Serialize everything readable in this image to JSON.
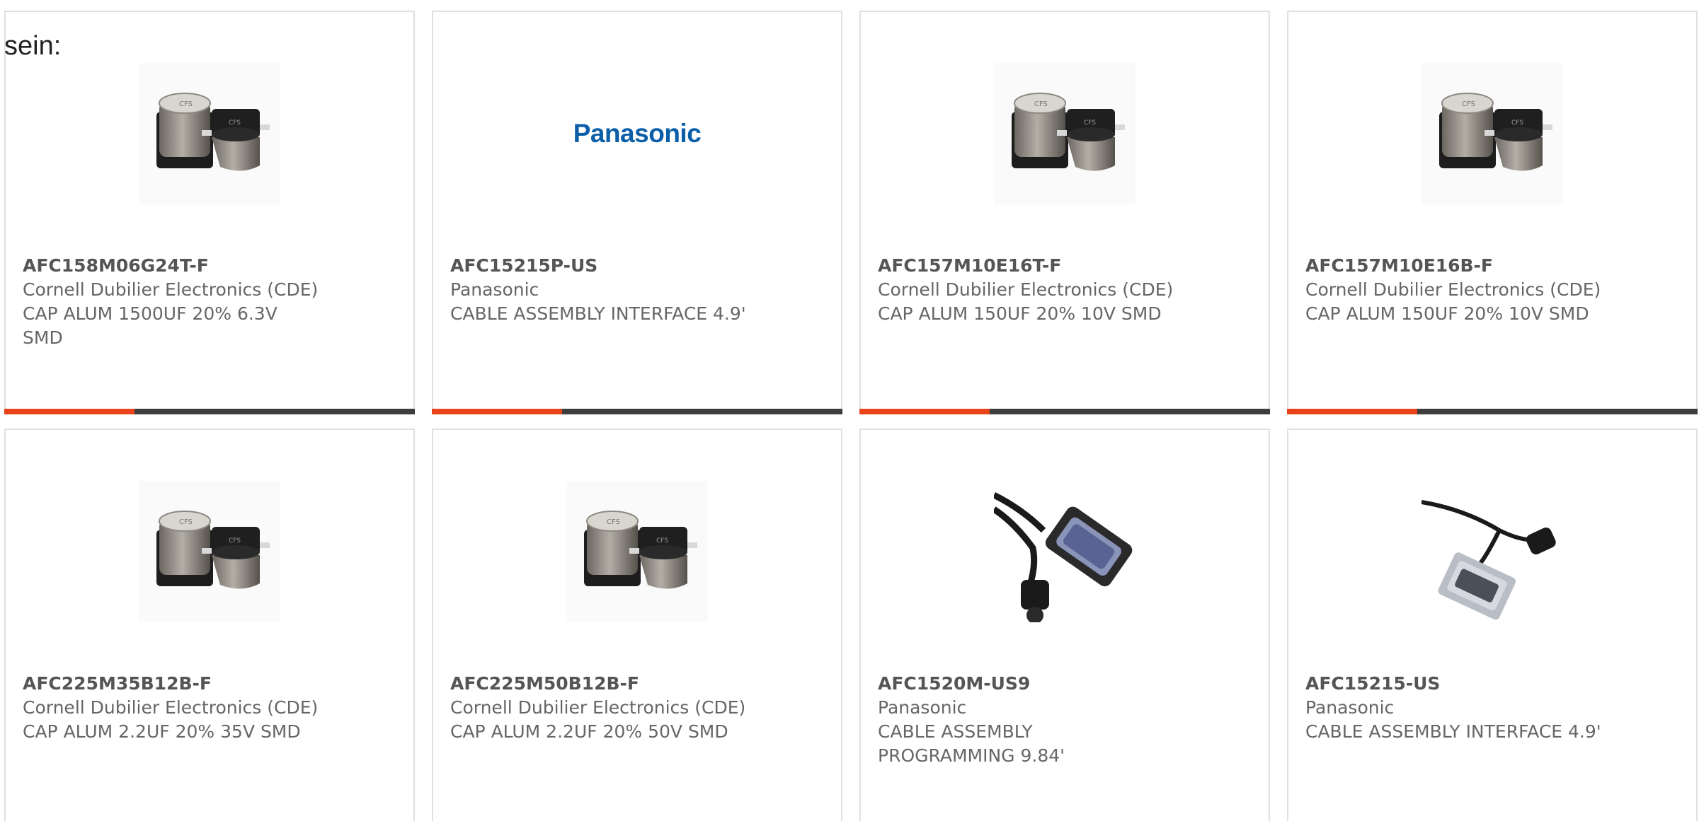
{
  "intro_text": "sein:",
  "products": [
    {
      "part_number": "AFC158M06G24T-F",
      "manufacturer": "Cornell Dubilier Electronics (CDE)",
      "description": "CAP ALUM 1500UF 20% 6.3V SMD",
      "image": "capacitor"
    },
    {
      "part_number": "AFC15215P-US",
      "manufacturer": "Panasonic",
      "description": "CABLE ASSEMBLY INTERFACE 4.9'",
      "image": "panasonic-logo",
      "logo_text": "Panasonic"
    },
    {
      "part_number": "AFC157M10E16T-F",
      "manufacturer": "Cornell Dubilier Electronics (CDE)",
      "description": "CAP ALUM 150UF 20% 10V SMD",
      "image": "capacitor"
    },
    {
      "part_number": "AFC157M10E16B-F",
      "manufacturer": "Cornell Dubilier Electronics (CDE)",
      "description": "CAP ALUM 150UF 20% 10V SMD",
      "image": "capacitor"
    },
    {
      "part_number": "AFC225M35B12B-F",
      "manufacturer": "Cornell Dubilier Electronics (CDE)",
      "description": "CAP ALUM 2.2UF 20% 35V SMD",
      "image": "capacitor"
    },
    {
      "part_number": "AFC225M50B12B-F",
      "manufacturer": "Cornell Dubilier Electronics (CDE)",
      "description": "CAP ALUM 2.2UF 20% 50V SMD",
      "image": "capacitor"
    },
    {
      "part_number": "AFC1520M-US9",
      "manufacturer": "Panasonic",
      "description": "CABLE ASSEMBLY PROGRAMMING 9.84'",
      "image": "db9-cable"
    },
    {
      "part_number": "AFC15215-US",
      "manufacturer": "Panasonic",
      "description": "CABLE ASSEMBLY INTERFACE 4.9'",
      "image": "db15-cable"
    }
  ],
  "colors": {
    "accent": "#e8431b",
    "bar": "#3d3d3d",
    "border": "#e0e0e0",
    "text": "#666666",
    "panasonic_blue": "#0b5fa9"
  }
}
